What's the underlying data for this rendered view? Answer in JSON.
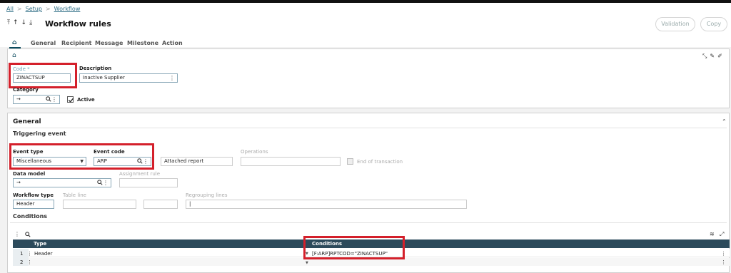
{
  "breadcrumb": [
    "All",
    "Setup",
    "Workflow"
  ],
  "page_title": "Workflow rules",
  "buttons": {
    "validation": "Validation",
    "copy": "Copy"
  },
  "tabs": [
    "General",
    "Recipient",
    "Message",
    "Milestone",
    "Action"
  ],
  "header_form": {
    "code_label": "Code *",
    "code_value": "ZINACTSUP",
    "description_label": "Description",
    "description_value": "Inactive Supplier",
    "category_label": "Category",
    "category_value": "→",
    "active_label": "Active"
  },
  "general": {
    "title": "General",
    "triggering_event": "Triggering event",
    "event_type_label": "Event type",
    "event_type_value": "Miscellaneous",
    "event_code_label": "Event code",
    "event_code_value": "ARP",
    "event_code_desc": "Attached report",
    "operations_label": "Operations",
    "end_of_transaction_label": "End of transaction",
    "data_model_label": "Data model",
    "data_model_value": "→",
    "assignment_rule_label": "Assignment rule",
    "workflow_type_label": "Workflow type",
    "workflow_type_value": "Header",
    "table_line_label": "Table line",
    "regrouping_lines_label": "Regrouping lines",
    "regrouping_value": "|"
  },
  "conditions": {
    "title": "Conditions",
    "columns": [
      "Type",
      "Conditions"
    ],
    "rows": [
      {
        "num": "1",
        "type": "Header",
        "condition": "[F:ARP]RPTCOD=\"ZINACTSUP\""
      },
      {
        "num": "2",
        "type": "",
        "condition": ""
      }
    ]
  },
  "colors": {
    "accent": "#0a4a5e",
    "grid_header": "#2c4a5b",
    "highlight": "#d4202b"
  }
}
